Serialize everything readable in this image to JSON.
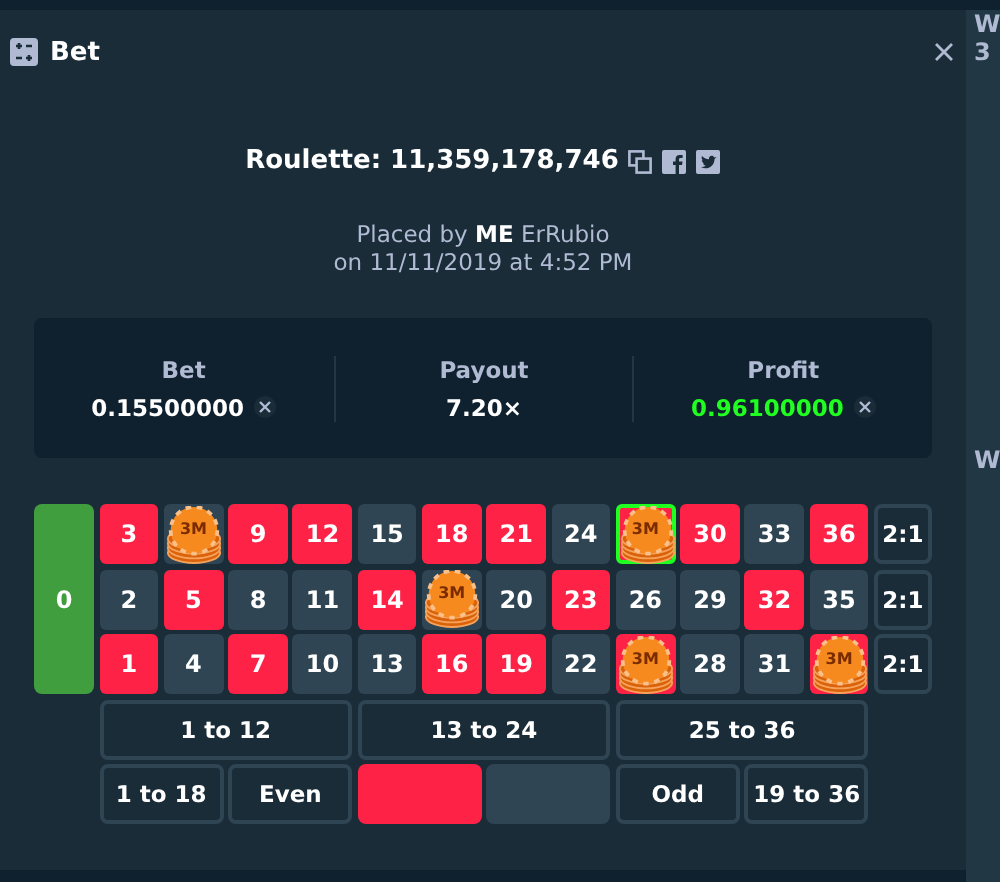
{
  "window": {
    "title": "Bet"
  },
  "header": {
    "title": "Roulette: 11,359,178,746",
    "placed_by": "Placed by **ME** ErRubio",
    "date": "on 11/11/2019 at 4:52 PM"
  },
  "stats": [
    {
      "label": "Bet",
      "value": "0.15500000",
      "currency_icon": true,
      "profit": false
    },
    {
      "label": "Payout",
      "value": "7.20×",
      "currency_icon": false,
      "profit": false
    },
    {
      "label": "Profit",
      "value": "0.96100000",
      "currency_icon": true,
      "profit": true
    }
  ],
  "board": {
    "zero": "0",
    "column_bets": [
      "2:1",
      "2:1",
      "2:1"
    ],
    "rows": [
      [
        {
          "number": "3",
          "color": "#fe2247",
          "highlighted": false
        },
        {
          "chip": "3M",
          "color": "#2f4553",
          "highlighted": false
        },
        {
          "number": "9",
          "color": "#fe2247",
          "highlighted": false
        },
        {
          "number": "12",
          "color": "#fe2247",
          "highlighted": false
        },
        {
          "number": "15",
          "color": "#2f4553",
          "highlighted": false
        },
        {
          "number": "18",
          "color": "#fe2247",
          "highlighted": false
        },
        {
          "number": "21",
          "color": "#fe2247",
          "highlighted": false
        },
        {
          "number": "24",
          "color": "#2f4553",
          "highlighted": false
        },
        {
          "chip": "3M",
          "color": "#fe2247",
          "highlighted": true
        },
        {
          "number": "30",
          "color": "#fe2247",
          "highlighted": false
        },
        {
          "number": "33",
          "color": "#2f4553",
          "highlighted": false
        },
        {
          "number": "36",
          "color": "#fe2247",
          "highlighted": false
        }
      ],
      [
        {
          "number": "2",
          "color": "#2f4553",
          "highlighted": false
        },
        {
          "number": "5",
          "color": "#fe2247",
          "highlighted": false
        },
        {
          "number": "8",
          "color": "#2f4553",
          "highlighted": false
        },
        {
          "number": "11",
          "color": "#2f4553",
          "highlighted": false
        },
        {
          "number": "14",
          "color": "#fe2247",
          "highlighted": false
        },
        {
          "chip": "3M",
          "color": "#2f4553",
          "highlighted": false
        },
        {
          "number": "20",
          "color": "#2f4553",
          "highlighted": false
        },
        {
          "number": "23",
          "color": "#fe2247",
          "highlighted": false
        },
        {
          "number": "26",
          "color": "#2f4553",
          "highlighted": false
        },
        {
          "number": "29",
          "color": "#2f4553",
          "highlighted": false
        },
        {
          "number": "32",
          "color": "#fe2247",
          "highlighted": false
        },
        {
          "number": "35",
          "color": "#2f4553",
          "highlighted": false
        }
      ],
      [
        {
          "number": "1",
          "color": "#fe2247",
          "highlighted": false
        },
        {
          "number": "4",
          "color": "#2f4553",
          "highlighted": false
        },
        {
          "number": "7",
          "color": "#fe2247",
          "highlighted": false
        },
        {
          "number": "10",
          "color": "#2f4553",
          "highlighted": false
        },
        {
          "number": "13",
          "color": "#2f4553",
          "highlighted": false
        },
        {
          "number": "16",
          "color": "#fe2247",
          "highlighted": false
        },
        {
          "number": "19",
          "color": "#fe2247",
          "highlighted": false
        },
        {
          "number": "22",
          "color": "#2f4553",
          "highlighted": false
        },
        {
          "chip": "3M",
          "color": "#fe2247",
          "highlighted": false
        },
        {
          "number": "28",
          "color": "#2f4553",
          "highlighted": false
        },
        {
          "number": "31",
          "color": "#2f4553",
          "highlighted": false
        },
        {
          "chip": "3M",
          "color": "#fe2247",
          "highlighted": false
        }
      ]
    ],
    "dozens": [
      "1 to 12",
      "13 to 24",
      "25 to 36"
    ],
    "outside": [
      {
        "kind": "text",
        "label": "1 to 18"
      },
      {
        "kind": "text",
        "label": "Even"
      },
      {
        "kind": "color",
        "color": "#fe2247"
      },
      {
        "kind": "color",
        "color": "#2f4553"
      },
      {
        "kind": "text",
        "label": "Odd"
      },
      {
        "kind": "text",
        "label": "19 to 36"
      }
    ]
  },
  "side_panel": {
    "texts": [
      "W",
      "3",
      "W"
    ]
  }
}
